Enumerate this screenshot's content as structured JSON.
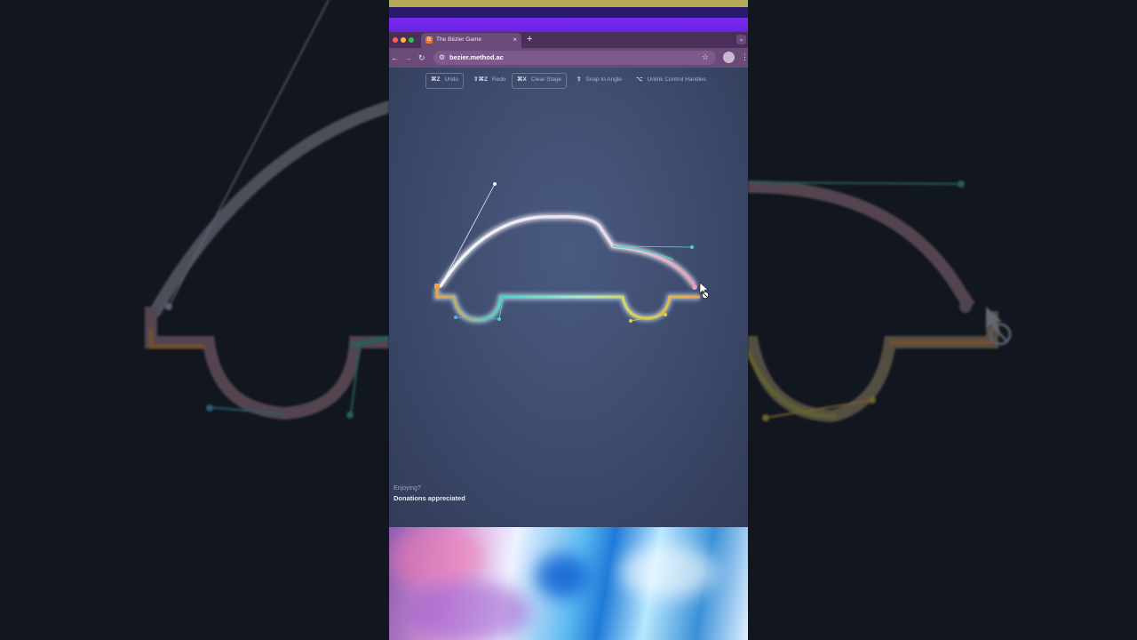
{
  "browser": {
    "tab": {
      "favicon": "bézier-favicon",
      "title": "The Bézier Game",
      "close": "×"
    },
    "new_tab": "+",
    "url": "bezier.method.ac"
  },
  "toolbar": {
    "undo": {
      "shortcut": "⌘Z",
      "label": "Undo"
    },
    "redo": {
      "shortcut": "⇧⌘Z",
      "label": "Redo"
    },
    "clear": {
      "shortcut": "⌘X",
      "label": "Clear Stage"
    },
    "snap": {
      "shortcut": "⇧",
      "label": "Snap to Angle"
    },
    "unlink": {
      "shortcut": "⌥",
      "label": "Unlink Control Handles"
    }
  },
  "footer": {
    "question": "Enjoying?",
    "donate": "Donations appreciated"
  },
  "colors": {
    "teal": "#4fd1c5",
    "pink": "#e89ab8",
    "orange": "#e8a24a",
    "yellow": "#d8d050",
    "white": "#f4f6ff"
  }
}
